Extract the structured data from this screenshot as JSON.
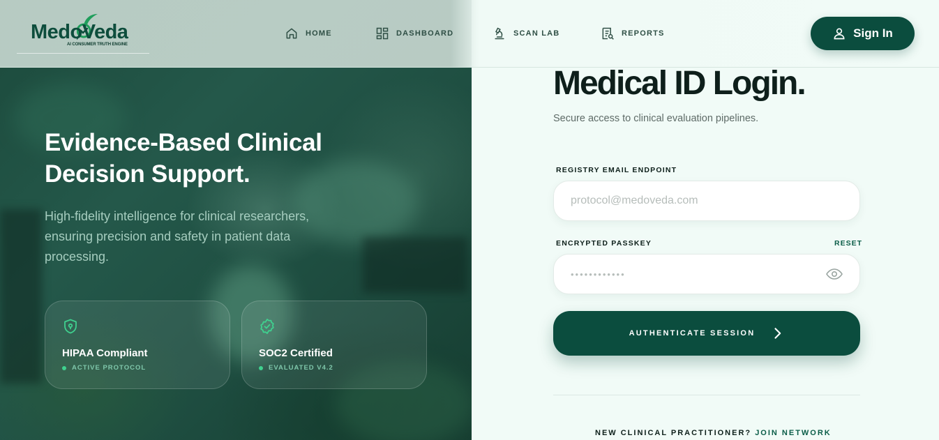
{
  "header": {
    "logo": {
      "wordmark": "MedoVeda",
      "tagline": "AI CONSUMER TRUTH ENGINE"
    },
    "nav": [
      {
        "label": "HOME",
        "icon": "home-icon"
      },
      {
        "label": "DASHBOARD",
        "icon": "dashboard-icon"
      },
      {
        "label": "SCAN LAB",
        "icon": "microscope-icon"
      },
      {
        "label": "REPORTS",
        "icon": "reports-icon"
      }
    ],
    "signin_label": "Sign In"
  },
  "hero": {
    "title": "Evidence-Based Clinical Decision Support.",
    "subtitle": "High-fidelity intelligence for clinical researchers, ensuring precision and safety in patient data processing.",
    "cards": [
      {
        "icon": "shield-lock-icon",
        "title": "HIPAA Compliant",
        "status": "ACTIVE PROTOCOL"
      },
      {
        "icon": "verified-badge-icon",
        "title": "SOC2 Certified",
        "status": "EVALUATED V4.2"
      }
    ]
  },
  "login": {
    "title": "Medical ID Login.",
    "subtitle": "Secure access to clinical evaluation pipelines.",
    "email_label": "REGISTRY EMAIL ENDPOINT",
    "email_placeholder": "protocol@medoveda.com",
    "password_label": "ENCRYPTED PASSKEY",
    "password_value": "••••••••••••",
    "reset_label": "RESET",
    "submit_label": "AUTHENTICATE SESSION",
    "footer_prompt": "NEW CLINICAL PRACTITIONER?",
    "footer_link": "JOIN NETWORK"
  },
  "colors": {
    "brand": "#0b4d3e",
    "accent_green": "#3fd18f",
    "page_bg": "#f1fbf7"
  }
}
